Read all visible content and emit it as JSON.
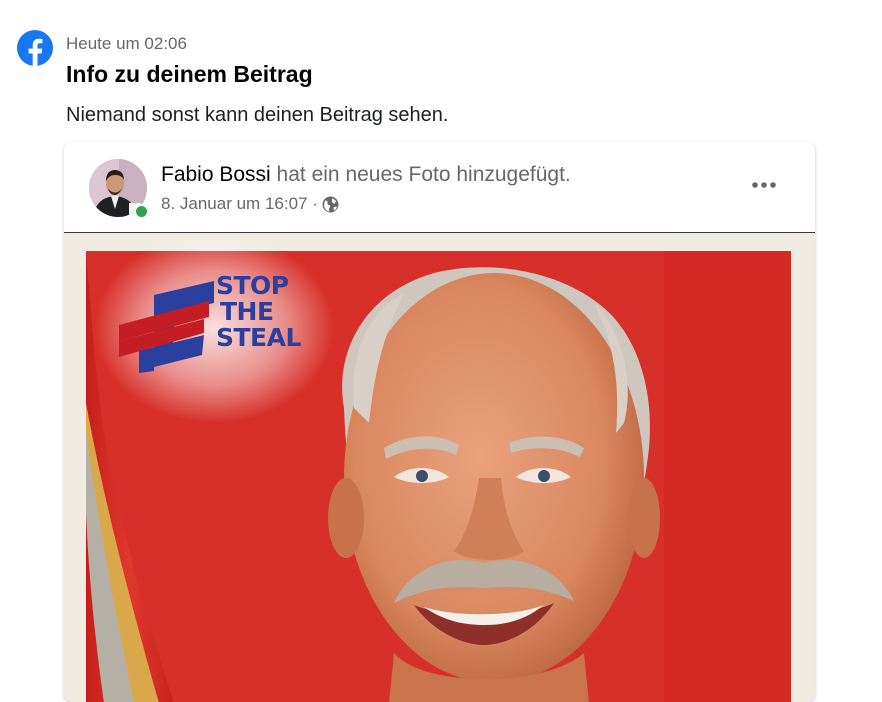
{
  "notification": {
    "icon": "facebook-icon",
    "timestamp": "Heute um 02:06",
    "title": "Info zu deinem Beitrag",
    "subtitle": "Niemand sonst kann deinen Beitrag sehen."
  },
  "post": {
    "author": "Fabio Bossi",
    "action": " hat ein neues Foto hinzugefügt.",
    "date": "8. Januar um 16:07 ·",
    "privacy_icon": "globe-icon",
    "menu_icon": "more-options-icon"
  },
  "photo_overlay": {
    "logo_line1": "STOP",
    "logo_line2": "THE",
    "logo_line3": "STEAL"
  },
  "colors": {
    "facebook_blue": "#1877f2",
    "online_green": "#31a24c",
    "poster_red": "#d7302a",
    "logo_blue": "#2a3f9e"
  }
}
